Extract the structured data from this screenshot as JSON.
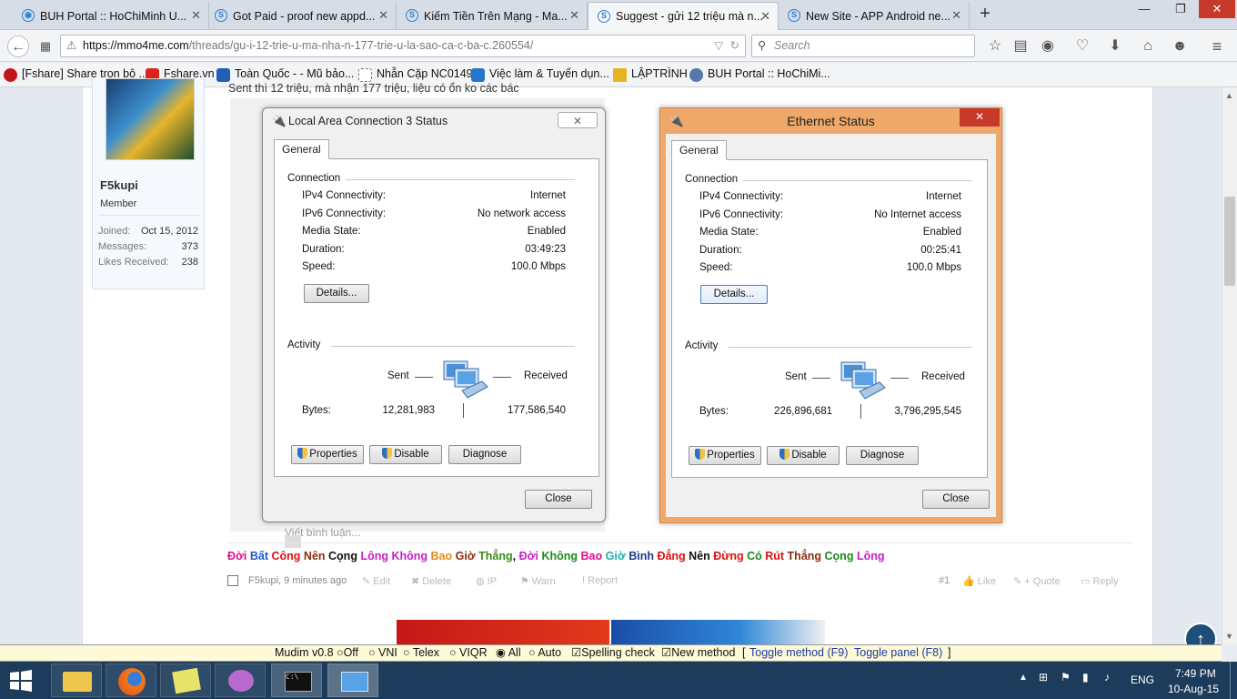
{
  "tabs": [
    {
      "title": "BUH Portal :: HoChiMinh U...",
      "active": false
    },
    {
      "title": "Got Paid - proof new appd...",
      "active": false
    },
    {
      "title": "Kiếm Tiền Trên Mạng - Ma...",
      "active": false
    },
    {
      "title": "Suggest - gửi 12 triệu mà n...",
      "active": true
    },
    {
      "title": "New Site - APP Android ne...",
      "active": false
    }
  ],
  "newtab_label": "+",
  "window_controls": {
    "minimize": "—",
    "maximize": "❐",
    "close": "✕"
  },
  "url": {
    "domain": "https://mmo4me.com",
    "path": "/threads/gu-i-12-trie-u-ma-nha-n-177-trie-u-la-sao-ca-c-ba-c.260554/"
  },
  "search_placeholder": "Search",
  "bookmarks": [
    {
      "label": "[Fshare] Share trọn bộ ...",
      "color": "#c3161c"
    },
    {
      "label": "Fshare.vn",
      "color": "#d9261c"
    },
    {
      "label": "Toàn Quốc - - Mũ bảo...",
      "color": "#1f5fb5"
    },
    {
      "label": "Nhẫn Cặp NC0149",
      "color": "#999999"
    },
    {
      "label": "Việc làm & Tuyển dụn...",
      "color": "#2277cc"
    },
    {
      "label": "LẬPTRÌNH",
      "color": "#e6b422"
    },
    {
      "label": "BUH Portal :: HoChiMi...",
      "color": "#5577aa"
    }
  ],
  "post": {
    "intro_text": "Sent thì 12 triệu, mà nhận 177 triệu, liệu có ổn ko các bác",
    "author": "F5kupi",
    "role": "Member",
    "stats": [
      {
        "label": "Joined:",
        "value": "Oct 15, 2012"
      },
      {
        "label": "Messages:",
        "value": "373"
      },
      {
        "label": "Likes Received:",
        "value": "238"
      }
    ],
    "reply_placeholder": "Viết bình luận...",
    "signature": [
      {
        "text": "Đời ",
        "color": "#e0118c"
      },
      {
        "text": "Bất ",
        "color": "#1a5ad6"
      },
      {
        "text": "Công ",
        "color": "#e01010"
      },
      {
        "text": "Nên ",
        "color": "#8b2e0e"
      },
      {
        "text": "Cọng ",
        "color": "#111111"
      },
      {
        "text": "Lông ",
        "color": "#c81ec8"
      },
      {
        "text": "Không ",
        "color": "#c81ec8"
      },
      {
        "text": "Bao ",
        "color": "#e8891a"
      },
      {
        "text": "Giờ ",
        "color": "#8b2e0e"
      },
      {
        "text": "Thẳng",
        "color": "#3a8a1a"
      },
      {
        "text": ", ",
        "color": "#111111"
      },
      {
        "text": "Đời ",
        "color": "#c81ec8"
      },
      {
        "text": "Không ",
        "color": "#1a8a1a"
      },
      {
        "text": "Bao ",
        "color": "#e0118c"
      },
      {
        "text": "Giờ ",
        "color": "#1ab0b0"
      },
      {
        "text": "Bình ",
        "color": "#1a3a8a"
      },
      {
        "text": "Đẳng ",
        "color": "#e01010"
      },
      {
        "text": "Nên ",
        "color": "#111111"
      },
      {
        "text": "Đừng ",
        "color": "#e01010"
      },
      {
        "text": "Có ",
        "color": "#1a8a1a"
      },
      {
        "text": "Rút ",
        "color": "#e01010"
      },
      {
        "text": "Thẳng ",
        "color": "#8b2e0e"
      },
      {
        "text": "Cọng ",
        "color": "#1a8a1a"
      },
      {
        "text": "Lông",
        "color": "#c81ec8"
      }
    ],
    "meta": "F5kupi, 9 minutes ago",
    "actions": [
      "Edit",
      "Delete",
      "IP",
      "Warn",
      "Report"
    ],
    "post_number": "#1",
    "footer_actions": [
      "Like",
      "+ Quote",
      "Reply"
    ]
  },
  "dialog1": {
    "title": "Local Area Connection 3 Status",
    "tab": "General",
    "connection_heading": "Connection",
    "rows": [
      {
        "label": "IPv4 Connectivity:",
        "value": "Internet"
      },
      {
        "label": "IPv6 Connectivity:",
        "value": "No network access"
      },
      {
        "label": "Media State:",
        "value": "Enabled"
      },
      {
        "label": "Duration:",
        "value": "03:49:23"
      },
      {
        "label": "Speed:",
        "value": "100.0 Mbps"
      }
    ],
    "details_button": "Details...",
    "activity_heading": "Activity",
    "sent_label": "Sent",
    "received_label": "Received",
    "bytes_label": "Bytes:",
    "bytes_sent": "12,281,983",
    "bytes_received": "177,586,540",
    "buttons": [
      "Properties",
      "Disable",
      "Diagnose"
    ],
    "close_button": "Close"
  },
  "dialog2": {
    "title": "Ethernet Status",
    "tab": "General",
    "connection_heading": "Connection",
    "rows": [
      {
        "label": "IPv4 Connectivity:",
        "value": "Internet"
      },
      {
        "label": "IPv6 Connectivity:",
        "value": "No Internet access"
      },
      {
        "label": "Media State:",
        "value": "Enabled"
      },
      {
        "label": "Duration:",
        "value": "00:25:41"
      },
      {
        "label": "Speed:",
        "value": "100.0 Mbps"
      }
    ],
    "details_button": "Details...",
    "activity_heading": "Activity",
    "sent_label": "Sent",
    "received_label": "Received",
    "bytes_label": "Bytes:",
    "bytes_sent": "226,896,681",
    "bytes_received": "3,796,295,545",
    "buttons": [
      "Properties",
      "Disable",
      "Diagnose"
    ],
    "close_button": "Close"
  },
  "mudim": {
    "prefix": "Mudim v0.8",
    "options": [
      "Off",
      "VNI",
      "Telex",
      "VIQR",
      "All",
      "Auto"
    ],
    "selected": "All",
    "checks": [
      "Spelling check",
      "New method"
    ],
    "links_open": "[",
    "toggle_method": "Toggle method (F9)",
    "toggle_panel": "Toggle panel (F8)",
    "links_close": "]"
  },
  "taskbar": {
    "language": "ENG",
    "time": "7:49 PM",
    "date": "10-Aug-15"
  }
}
